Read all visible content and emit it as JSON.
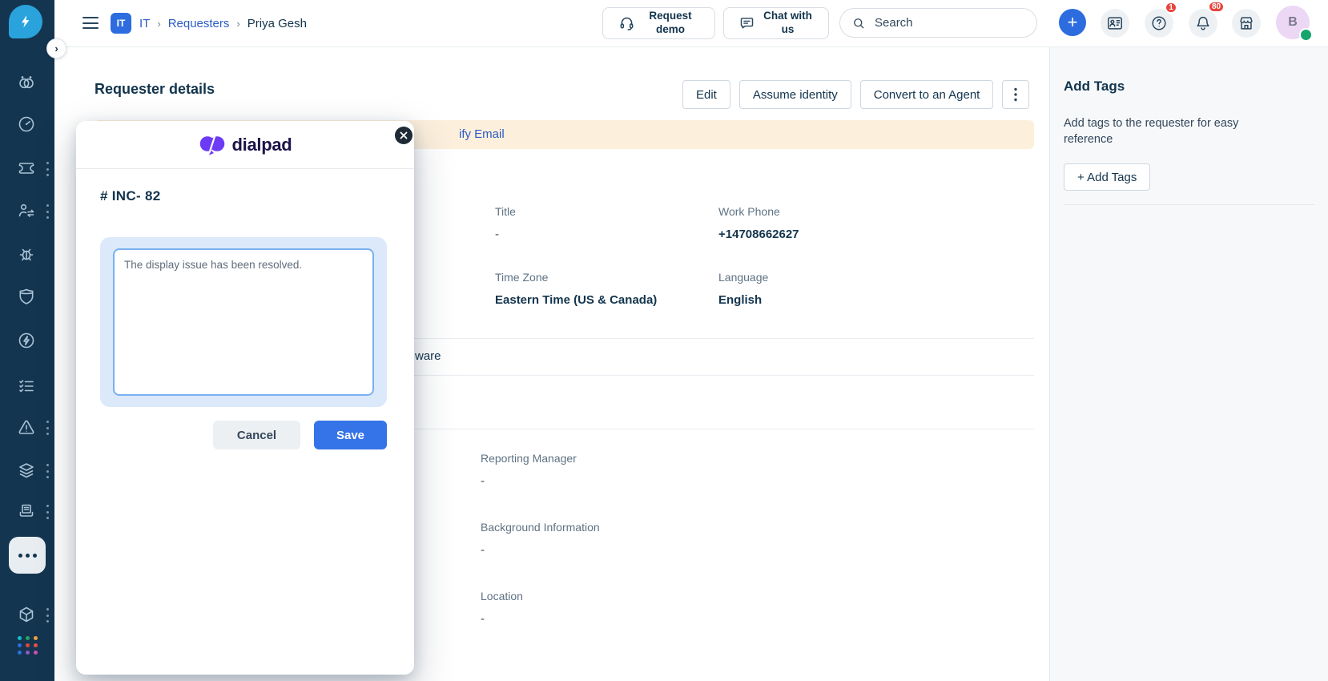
{
  "navbar": {
    "breadcrumb": {
      "badge": "IT",
      "items": [
        "IT",
        "Requesters",
        "Priya Gesh"
      ]
    },
    "request_demo_label": "Request demo",
    "chat_with_us_label": "Chat with us",
    "search_placeholder": "Search",
    "help_badge_count": "1",
    "notification_badge_count": "80",
    "avatar_initial": "B"
  },
  "sidebar": {
    "icons": [
      "freshservice-logo",
      "copilot",
      "dashboard",
      "tickets",
      "requesters",
      "bugs",
      "security",
      "sandbox",
      "tasks",
      "problems",
      "changes",
      "contracts",
      "more",
      "assets",
      "app-switcher"
    ]
  },
  "page": {
    "title": "Requester details",
    "actions": {
      "edit": "Edit",
      "assume_identity": "Assume identity",
      "convert_to_agent": "Convert to an Agent"
    },
    "banner": {
      "link_fragment": "ify Email"
    },
    "section_fragment": "ware",
    "fields": {
      "title": {
        "label": "Title",
        "value": "-"
      },
      "work_phone": {
        "label": "Work Phone",
        "value": "+14708662627"
      },
      "time_zone": {
        "label": "Time Zone",
        "value": "Eastern Time (US & Canada)"
      },
      "language": {
        "label": "Language",
        "value": "English"
      },
      "reporting_manager": {
        "label": "Reporting Manager",
        "value": "-"
      },
      "background_information": {
        "label": "Background Information",
        "value": "-"
      },
      "location": {
        "label": "Location",
        "value": "-"
      }
    }
  },
  "tags_panel": {
    "title": "Add Tags",
    "description": "Add tags to the requester for easy reference",
    "button_label": "+ Add Tags"
  },
  "modal": {
    "brand": "dialpad",
    "ticket_id": "# INC- 82",
    "note_text": "The display issue has been resolved.",
    "cancel_label": "Cancel",
    "save_label": "Save"
  },
  "colors": {
    "accent_blue": "#2d6cdf",
    "sidebar_navy": "#14354f",
    "banner_peach": "#fcefdc",
    "save_blue": "#3473e8",
    "dialpad_purple": "#6d3bf5",
    "badge_red": "#e8453c",
    "presence_green": "#16a56f"
  }
}
